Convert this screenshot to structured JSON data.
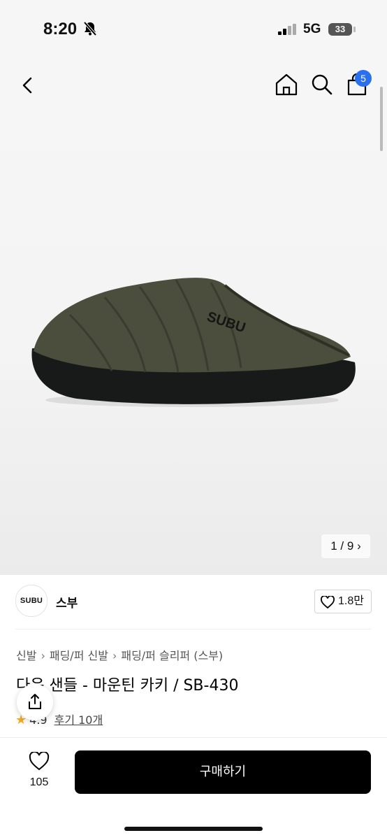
{
  "status_bar": {
    "time": "8:20",
    "network": "5G",
    "battery": "33"
  },
  "top_nav": {
    "cart_count": "5"
  },
  "gallery": {
    "indicator": "1 / 9",
    "image_logo_text": "SUBU"
  },
  "brand": {
    "logo_text": "SUBU",
    "name": "스부",
    "likes": "1.8만"
  },
  "breadcrumb": [
    "신발",
    "패딩/퍼 신발",
    "패딩/퍼 슬리퍼 (스부)"
  ],
  "product": {
    "title": "다운 샌들 - 마운틴 카키 / SB-430",
    "rating": "4.9",
    "reviews": "후기 10개"
  },
  "bottom": {
    "wish_count": "105",
    "buy_label": "구매하기"
  },
  "colors": {
    "accent": "#2b6ff1",
    "star": "#f5a623",
    "button": "#000000"
  }
}
